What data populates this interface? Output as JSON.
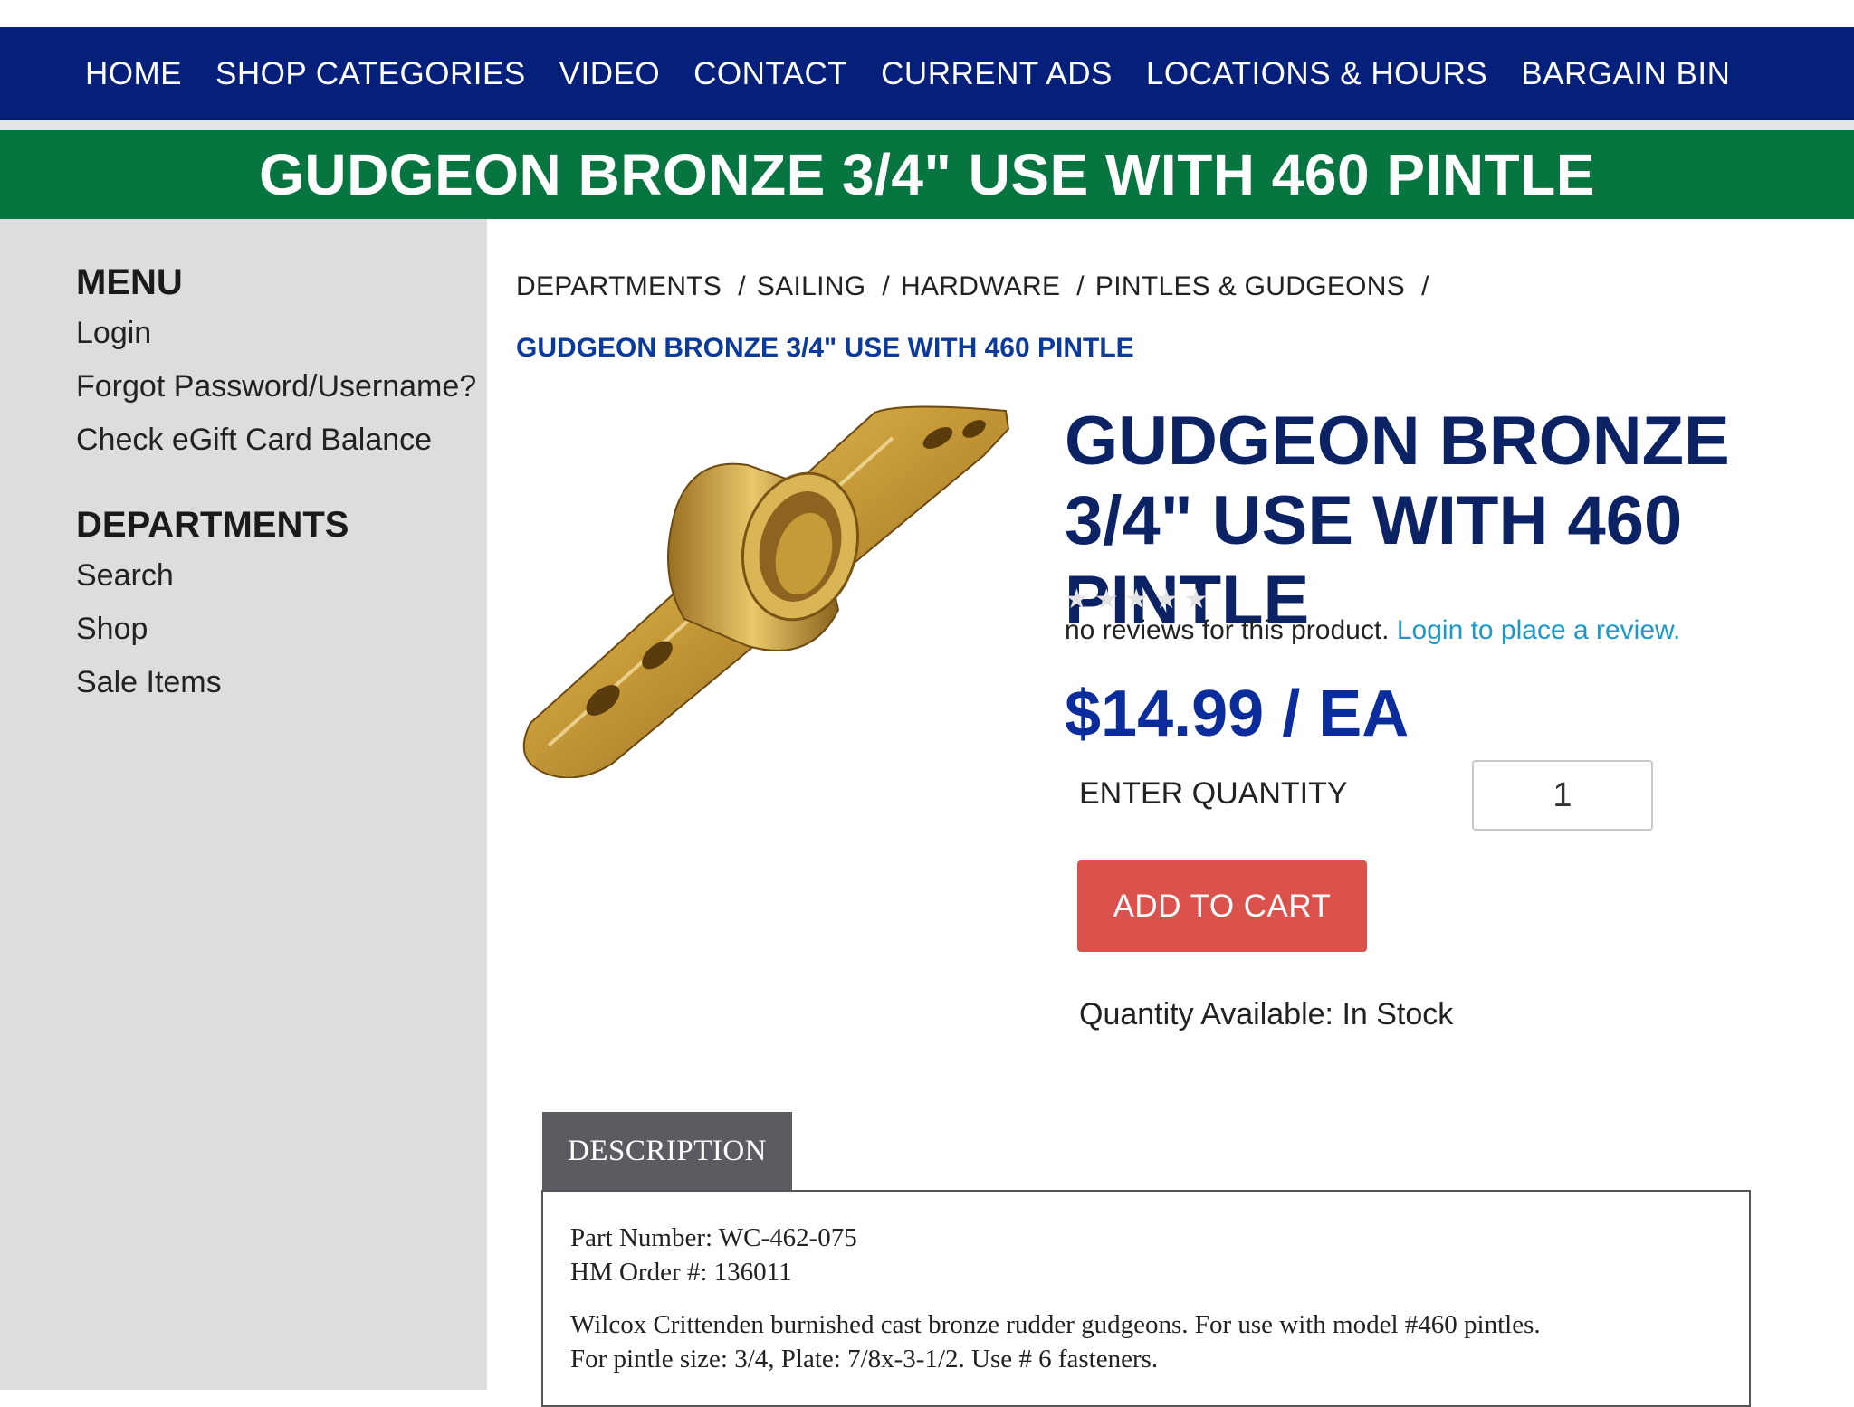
{
  "nav": {
    "items": [
      "HOME",
      "SHOP CATEGORIES",
      "VIDEO",
      "CONTACT",
      "CURRENT ADS",
      "LOCATIONS & HOURS",
      "BARGAIN BIN"
    ]
  },
  "banner": {
    "title": "GUDGEON BRONZE 3/4\" USE WITH 460 PINTLE"
  },
  "sidebar": {
    "menu_heading": "MENU",
    "menu_items": [
      "Login",
      "Forgot Password/Username?",
      "Check eGift Card Balance"
    ],
    "departments_heading": "DEPARTMENTS",
    "department_items": [
      "Search",
      "Shop",
      "Sale Items"
    ]
  },
  "breadcrumb": {
    "items": [
      "DEPARTMENTS",
      "SAILING",
      "HARDWARE",
      "PINTLES & GUDGEONS"
    ],
    "separator": "/",
    "current": "GUDGEON BRONZE 3/4\" USE WITH 460 PINTLE"
  },
  "product": {
    "title": "GUDGEON BRONZE 3/4\" USE WITH 460 PINTLE",
    "rating": {
      "value": 0,
      "max": 5
    },
    "reviews_text": "no reviews for this product.",
    "review_link": "Login to place a review.",
    "price": "$14.99 / EA",
    "quantity_label": "ENTER QUANTITY",
    "quantity_value": "1",
    "add_to_cart": "ADD TO CART",
    "availability": "Quantity Available: In Stock",
    "image_icon": "bronze-gudgeon-product-photo"
  },
  "description": {
    "tab_label": "DESCRIPTION",
    "part_number": "Part Number: WC-462-075",
    "hm_order": "HM Order #: 136011",
    "text_line1": "Wilcox Crittenden burnished cast bronze rudder gudgeons. For use with model #460 pintles.",
    "text_line2": "For pintle size: 3/4, Plate: 7/8x-3-1/2. Use # 6 fasteners."
  },
  "colors": {
    "nav_bg": "#05207a",
    "banner_bg": "#067540",
    "sidebar_bg": "#dcdddf",
    "title_navy": "#0b2364",
    "price_blue": "#0b2c9c",
    "link_blue": "#1e98c9",
    "cart_red": "#db514c",
    "tab_gray": "#5a5c61"
  }
}
